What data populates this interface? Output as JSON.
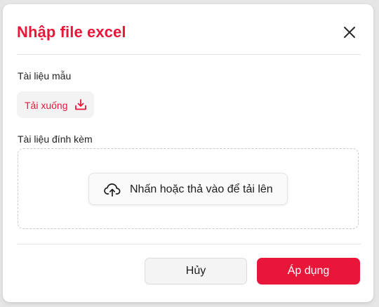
{
  "dialog": {
    "title": "Nhập file excel",
    "close_icon": "close-icon",
    "template_label": "Tài liệu mẫu",
    "download_label": "Tải xuống",
    "download_icon": "download-icon",
    "attach_label": "Tài liệu đính kèm",
    "upload_label": "Nhấn hoặc thả vào để tải lên",
    "upload_icon": "cloud-upload-icon",
    "cancel_label": "Hủy",
    "apply_label": "Áp dụng"
  },
  "colors": {
    "accent": "#e8173a",
    "backdrop": "#e6e6e6",
    "dialog_bg": "#ffffff"
  }
}
